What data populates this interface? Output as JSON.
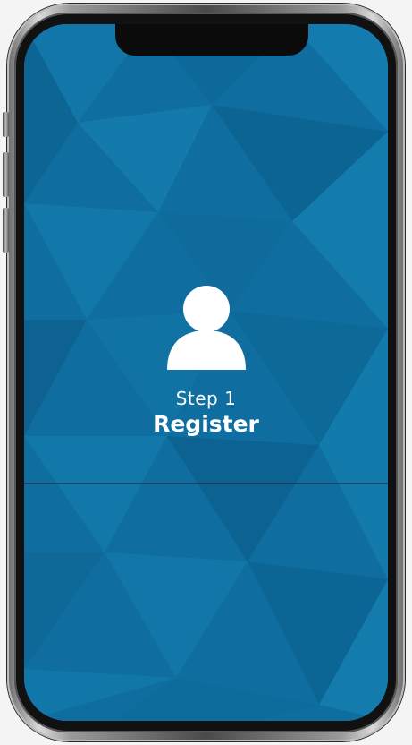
{
  "onboarding": {
    "step_label": "Step 1",
    "step_title": "Register",
    "icon": "user-icon"
  },
  "colors": {
    "screen_background": "#0f6e9f",
    "text": "#ffffff"
  }
}
